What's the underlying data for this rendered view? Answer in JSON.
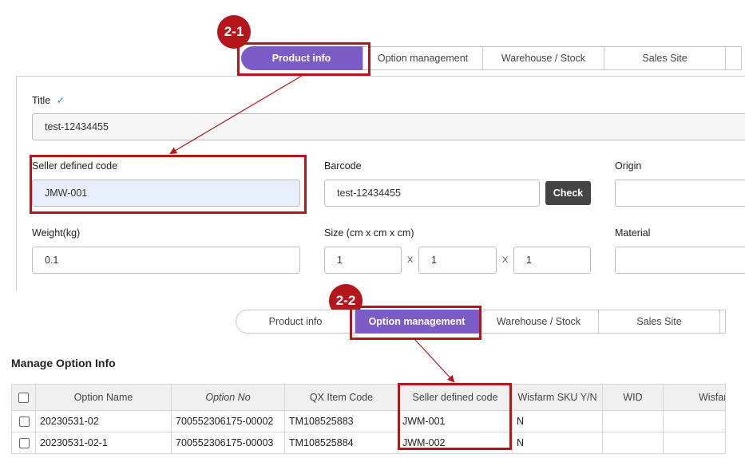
{
  "top_tabs": [
    "Product info",
    "Option management",
    "Warehouse / Stock",
    "Sales Site"
  ],
  "top_tab_active": "Product info",
  "badge_top": "2-1",
  "badge_bottom": "2-2",
  "form": {
    "title_label": "Title",
    "title_value": "test-12434455",
    "seller_code_label": "Seller defined code",
    "seller_code_value": "JMW-001",
    "barcode_label": "Barcode",
    "barcode_value": "test-12434455",
    "check_button": "Check",
    "origin_label": "Origin",
    "weight_label": "Weight(kg)",
    "weight_value": "0.1",
    "size_label": "Size (cm x cm x cm)",
    "size_values": [
      "1",
      "1",
      "1"
    ],
    "size_sep": "X",
    "material_label": "Material"
  },
  "bottom_tabs": [
    "Product info",
    "Option management",
    "Warehouse / Stock",
    "Sales Site"
  ],
  "bottom_tab_active": "Option management",
  "section_title": "Manage Option Info",
  "table": {
    "headers": [
      "Option Name",
      "Option No",
      "QX Item Code",
      "Seller defined code",
      "Wisfarm SKU Y/N",
      "WID",
      "Wisfarm"
    ],
    "rows": [
      [
        "20230531-02",
        "700552306175-00002",
        "TM108525883",
        "JWM-001",
        "N",
        "",
        ""
      ],
      [
        "20230531-02-1",
        "700552306175-00003",
        "TM108525884",
        "JWM-002",
        "N",
        "",
        ""
      ]
    ]
  },
  "colors": {
    "accent": "#7b5cc6",
    "annotation": "#b4161b",
    "field_highlight": "#e8effc"
  }
}
